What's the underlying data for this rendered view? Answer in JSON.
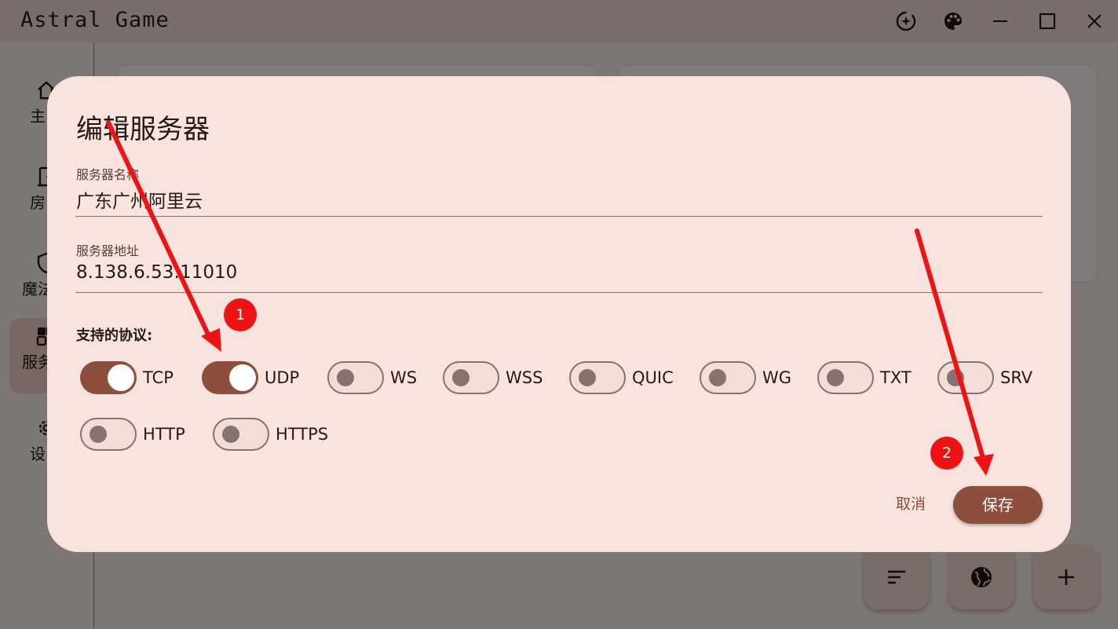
{
  "window": {
    "title": "Astral Game",
    "controls": [
      "sparkle-refresh-icon",
      "palette-icon",
      "minimize-icon",
      "maximize-icon",
      "close-icon"
    ]
  },
  "sidebar": {
    "items": [
      {
        "label": "主",
        "icon": "home-icon"
      },
      {
        "label": "房",
        "icon": "door-icon"
      },
      {
        "label": "魔法",
        "icon": "shield-icon"
      },
      {
        "label": "服务",
        "icon": "server-icon",
        "active": true
      },
      {
        "label": "设",
        "icon": "gear-icon"
      }
    ]
  },
  "fabs": [
    {
      "icon": "sort-icon"
    },
    {
      "icon": "globe-icon"
    },
    {
      "icon": "add-icon"
    }
  ],
  "dialog": {
    "title": "编辑服务器",
    "name_field": {
      "label": "服务器名称",
      "value": "广东广州阿里云"
    },
    "address_field": {
      "label": "服务器地址",
      "value": "8.138.6.53:11010"
    },
    "protocols_label": "支持的协议:",
    "protocols": [
      {
        "label": "TCP",
        "on": true
      },
      {
        "label": "UDP",
        "on": true
      },
      {
        "label": "WS",
        "on": false
      },
      {
        "label": "WSS",
        "on": false
      },
      {
        "label": "QUIC",
        "on": false
      },
      {
        "label": "WG",
        "on": false
      },
      {
        "label": "TXT",
        "on": false
      },
      {
        "label": "SRV",
        "on": false
      },
      {
        "label": "HTTP",
        "on": false
      },
      {
        "label": "HTTPS",
        "on": false
      }
    ],
    "cancel_label": "取消",
    "save_label": "保存"
  },
  "annotations": {
    "badges": [
      "1",
      "2"
    ],
    "color": "#ee1212"
  },
  "colors": {
    "primary": "#8e4e3c",
    "dialog_bg": "#f8e3df",
    "outline": "#85736f"
  }
}
